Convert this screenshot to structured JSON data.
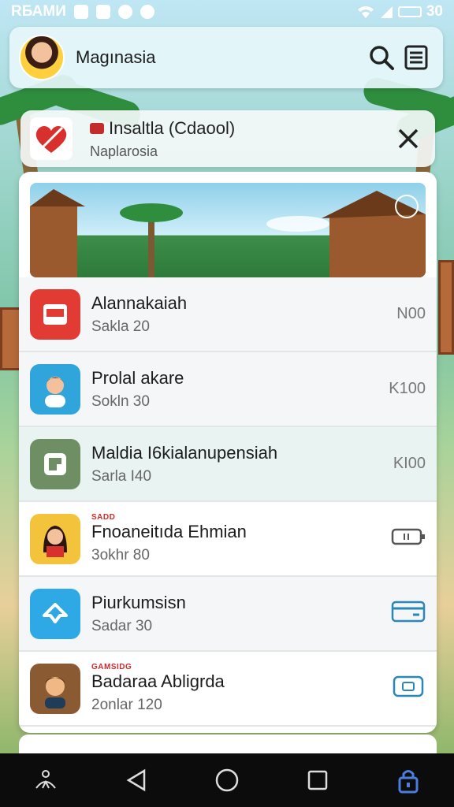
{
  "status_bar": {
    "carrier": "RБАМИ",
    "time": "30"
  },
  "header": {
    "title": "Magınasia"
  },
  "notification": {
    "title": "Insaltla (Cdaool)",
    "subtitle": "Naplarosia"
  },
  "list": {
    "items": [
      {
        "title": "Alannakaiah",
        "subtitle": "Sakla  20",
        "label": "",
        "right": "N00",
        "icon": "calendar-icon",
        "color": "#e23b34"
      },
      {
        "title": "Prolal akare",
        "subtitle": "Sokln  30",
        "label": "",
        "right": "K100",
        "icon": "person-avatar",
        "color": "#2fa5dc"
      },
      {
        "title": "Maldia I6kialanupensiah",
        "subtitle": "Sarla  I40",
        "label": "",
        "right": "KI00",
        "icon": "bag-icon",
        "color": "#6e8e63"
      },
      {
        "title": "Fnoaneitıda Ehmian",
        "subtitle": "3okhr  80",
        "label": "SADD",
        "right": "",
        "icon": "person-avatar",
        "color": "#f3c33b"
      },
      {
        "title": "Piurkumsisn",
        "subtitle": "Sadar  30",
        "label": "",
        "right": "",
        "icon": "chat-icon",
        "color": "#2ea9e5"
      },
      {
        "title": "Badaraa Abligrda",
        "subtitle": "2onlar 120",
        "label": "GAMSIDG",
        "right": "",
        "icon": "person-avatar",
        "color": "#8a5a32"
      }
    ]
  },
  "colors": {
    "accent": "#e23b34",
    "panel": "#ffffff",
    "navbar": "#0c0c0c"
  }
}
